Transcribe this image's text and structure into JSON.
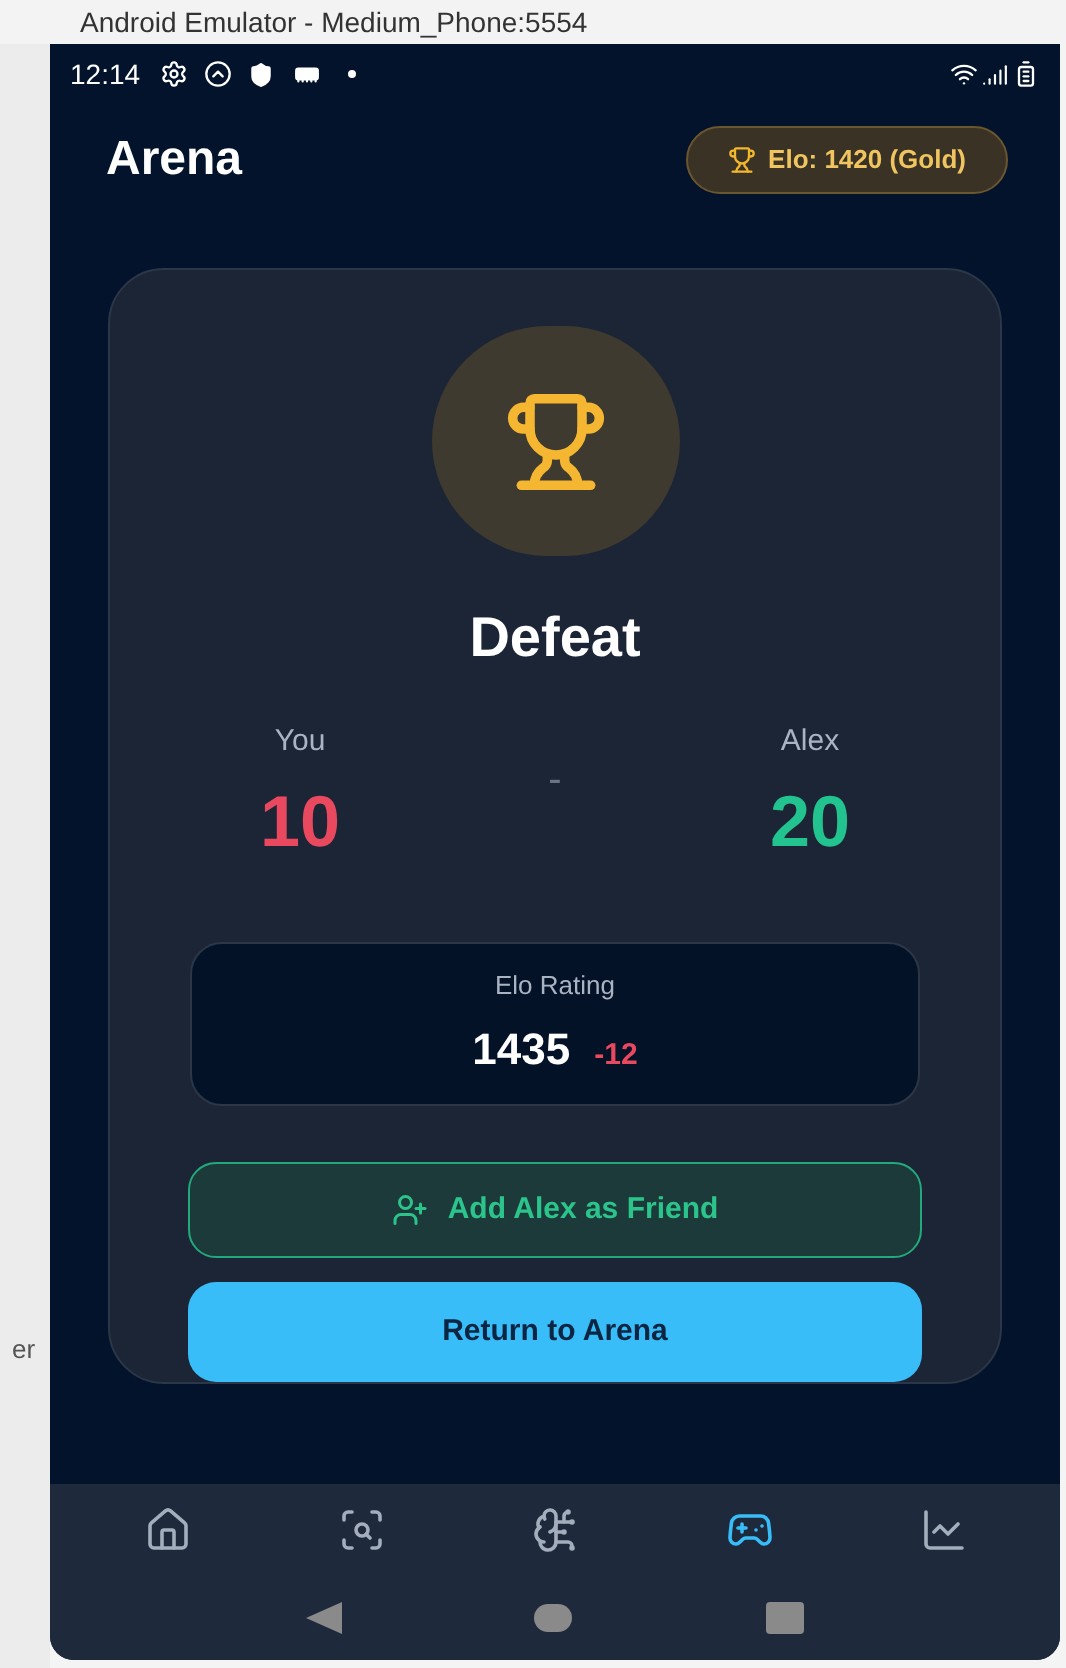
{
  "window": {
    "title": "Android Emulator - Medium_Phone:5554"
  },
  "side_text": "er",
  "status_bar": {
    "time": "12:14"
  },
  "header": {
    "title": "Arena",
    "badge": "Elo: 1420 (Gold)"
  },
  "result": {
    "title": "Defeat",
    "separator": "-",
    "players": [
      {
        "name": "You",
        "score": "10",
        "color": "#e8495f"
      },
      {
        "name": "Alex",
        "score": "20",
        "color": "#22c38e"
      }
    ]
  },
  "elo": {
    "label": "Elo Rating",
    "value": "1435",
    "change": "-12",
    "color": "#e8495f"
  },
  "buttons": [
    {
      "label": "Add Alex as Friend",
      "kind": "outline"
    },
    {
      "label": "Return to Arena",
      "kind": "primary"
    }
  ],
  "nav": [
    {
      "kind": "home",
      "selected": false
    },
    {
      "kind": "scan",
      "selected": false
    },
    {
      "kind": "brain",
      "selected": false
    },
    {
      "kind": "game",
      "selected": true
    },
    {
      "kind": "chart",
      "selected": false
    }
  ]
}
